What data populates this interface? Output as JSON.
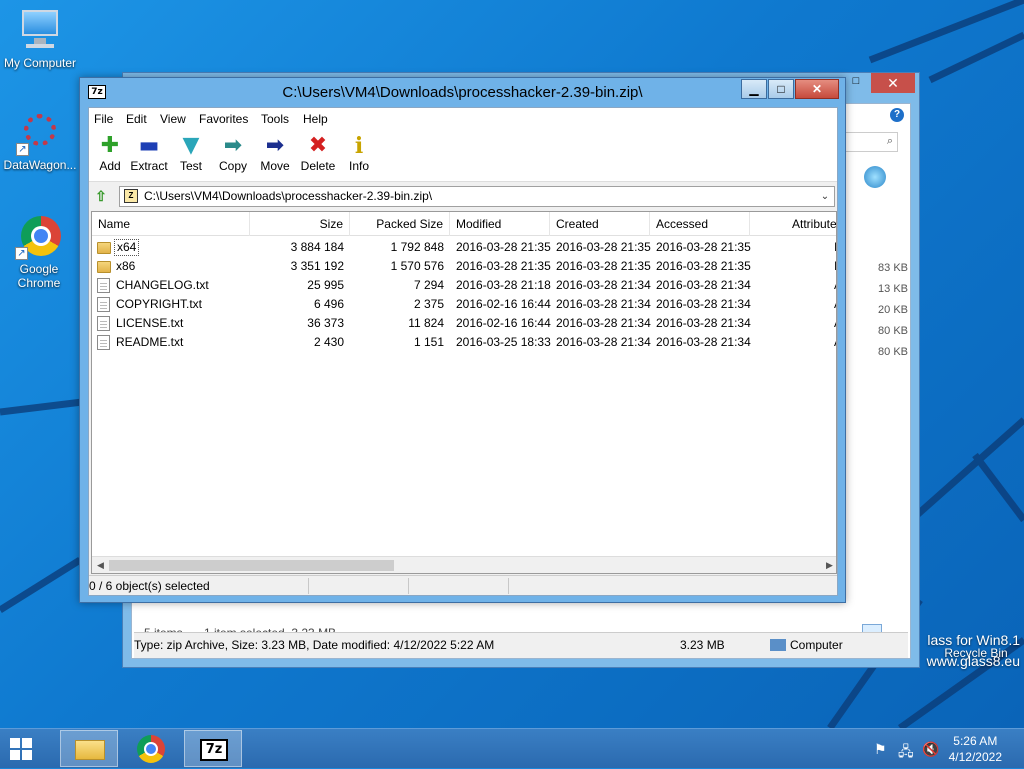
{
  "desktop": {
    "icons": [
      {
        "label": "My Computer"
      },
      {
        "label": "DataWagon..."
      },
      {
        "label": "Google Chrome"
      },
      {
        "label": "Recycle Bin"
      }
    ],
    "watermark": {
      "line1": "lass for Win8.1",
      "line2": "www.glass8.eu"
    }
  },
  "explorer": {
    "close_glyph": "✕",
    "sizes": [
      "83 KB",
      "13 KB",
      "20 KB",
      "80 KB",
      "80 KB"
    ],
    "items_count": "5 items",
    "selection": "1 item selected  3.23 MB",
    "status_text": "Type: zip Archive, Size: 3.23 MB, Date modified: 4/12/2022 5:22 AM",
    "status_size": "3.23 MB",
    "status_location": "Computer"
  },
  "sevenzip": {
    "app_icon_text": "7z",
    "title": "C:\\Users\\VM4\\Downloads\\processhacker-2.39-bin.zip\\",
    "minimize_glyph": "▁",
    "maximize_glyph": "□",
    "close_glyph": "✕",
    "menu": [
      "File",
      "Edit",
      "View",
      "Favorites",
      "Tools",
      "Help"
    ],
    "toolbar": [
      {
        "label": "Add",
        "glyph": "✚",
        "icon": "add-icon",
        "color": "#2ea12a"
      },
      {
        "label": "Extract",
        "glyph": "▬",
        "icon": "extract-icon",
        "color": "#1d3fb5"
      },
      {
        "label": "Test",
        "glyph": "▼",
        "icon": "test-icon",
        "color": "#2aa6b9"
      },
      {
        "label": "Copy",
        "glyph": "➡",
        "icon": "copy-icon",
        "color": "#2a8a8a"
      },
      {
        "label": "Move",
        "glyph": "➡",
        "icon": "move-icon",
        "color": "#1c2f8f"
      },
      {
        "label": "Delete",
        "glyph": "✖",
        "icon": "delete-icon",
        "color": "#d42020"
      },
      {
        "label": "Info",
        "glyph": "i",
        "icon": "info-icon",
        "color": "#c8a400"
      }
    ],
    "address": "C:\\Users\\VM4\\Downloads\\processhacker-2.39-bin.zip\\",
    "columns": [
      "Name",
      "Size",
      "Packed Size",
      "Modified",
      "Created",
      "Accessed",
      "Attribute"
    ],
    "rows": [
      {
        "name": "x64",
        "type": "folder",
        "size": "3 884 184",
        "packed": "1 792 848",
        "modified": "2016-03-28 21:35",
        "created": "2016-03-28 21:35",
        "accessed": "2016-03-28 21:35",
        "attr": "I"
      },
      {
        "name": "x86",
        "type": "folder",
        "size": "3 351 192",
        "packed": "1 570 576",
        "modified": "2016-03-28 21:35",
        "created": "2016-03-28 21:35",
        "accessed": "2016-03-28 21:35",
        "attr": "I"
      },
      {
        "name": "CHANGELOG.txt",
        "type": "file",
        "size": "25 995",
        "packed": "7 294",
        "modified": "2016-03-28 21:18",
        "created": "2016-03-28 21:34",
        "accessed": "2016-03-28 21:34",
        "attr": "A"
      },
      {
        "name": "COPYRIGHT.txt",
        "type": "file",
        "size": "6 496",
        "packed": "2 375",
        "modified": "2016-02-16 16:44",
        "created": "2016-03-28 21:34",
        "accessed": "2016-03-28 21:34",
        "attr": "A"
      },
      {
        "name": "LICENSE.txt",
        "type": "file",
        "size": "36 373",
        "packed": "11 824",
        "modified": "2016-02-16 16:44",
        "created": "2016-03-28 21:34",
        "accessed": "2016-03-28 21:34",
        "attr": "A"
      },
      {
        "name": "README.txt",
        "type": "file",
        "size": "2 430",
        "packed": "1 151",
        "modified": "2016-03-25 18:33",
        "created": "2016-03-28 21:34",
        "accessed": "2016-03-28 21:34",
        "attr": "A"
      }
    ],
    "status": "0 / 6 object(s) selected"
  },
  "taskbar": {
    "apps": [
      {
        "name": "File Explorer",
        "icon": "folder-icon"
      },
      {
        "name": "Google Chrome",
        "icon": "chrome-icon"
      },
      {
        "name": "7-Zip",
        "icon": "sevenzip-icon",
        "label": "7z"
      }
    ],
    "time": "5:26 AM",
    "date": "4/12/2022"
  }
}
